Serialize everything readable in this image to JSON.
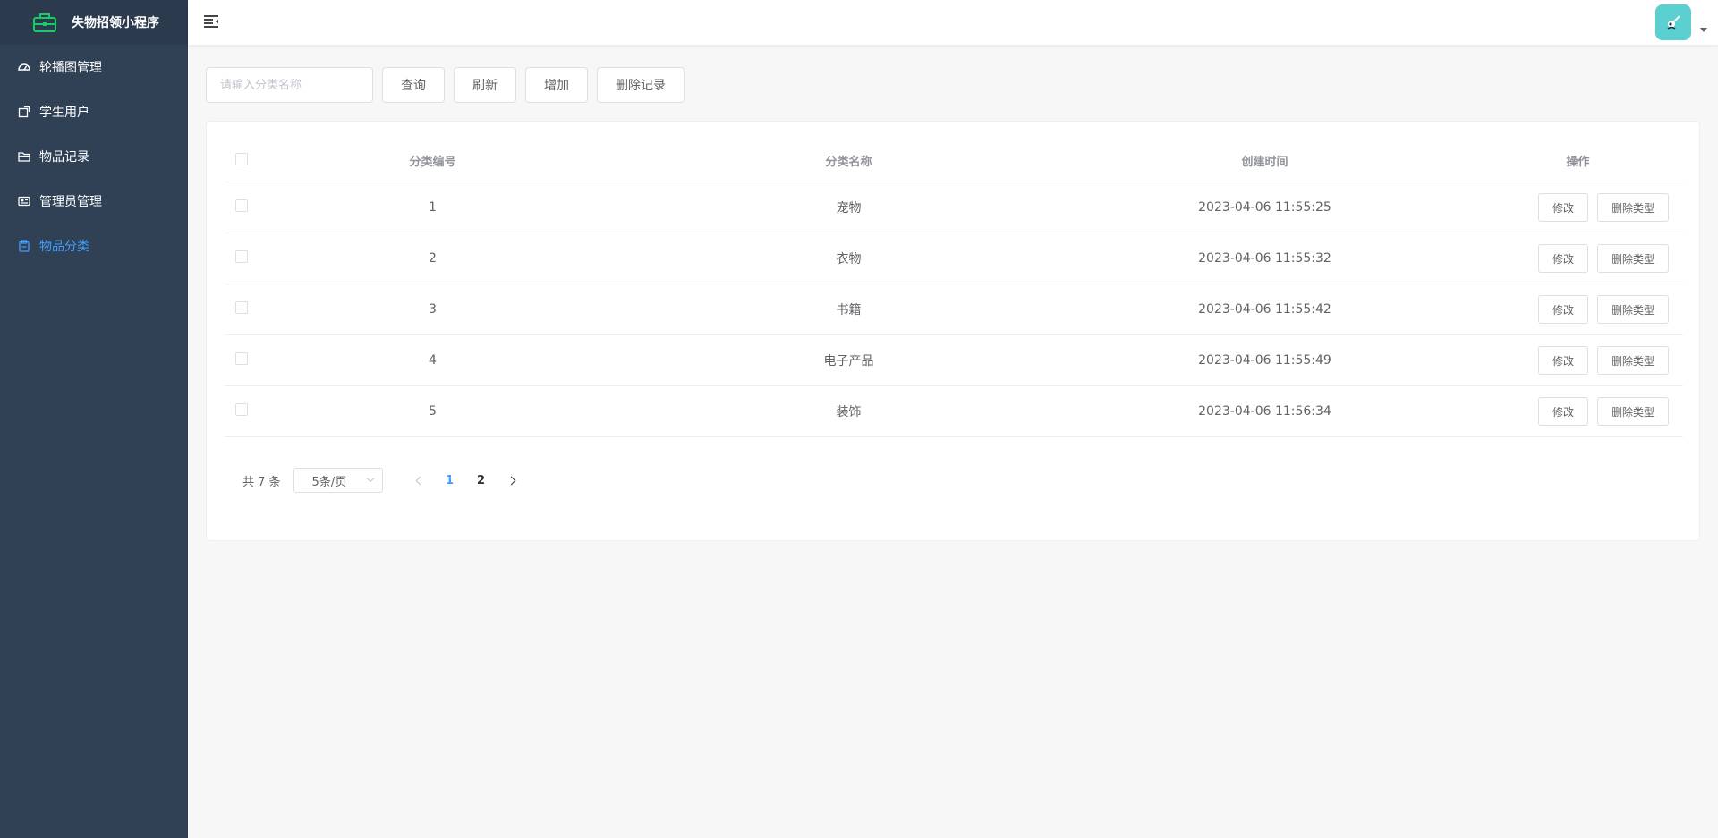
{
  "app": {
    "title": "失物招领小程序"
  },
  "sidebar": {
    "items": [
      {
        "label": "轮播图管理",
        "icon": "dashboard-icon",
        "active": false
      },
      {
        "label": "学生用户",
        "icon": "external-link-icon",
        "active": false
      },
      {
        "label": "物品记录",
        "icon": "folder-icon",
        "active": false
      },
      {
        "label": "管理员管理",
        "icon": "id-card-icon",
        "active": false
      },
      {
        "label": "物品分类",
        "icon": "clipboard-icon",
        "active": true
      }
    ]
  },
  "colors": {
    "sidebar_bg": "#304156",
    "logo_bg": "#2b3a4d",
    "accent": "#409eff",
    "logo_green": "#13ce66",
    "avatar_bg": "#5ccfd0"
  },
  "toolbar": {
    "search_placeholder": "请输入分类名称",
    "query_label": "查询",
    "refresh_label": "刷新",
    "add_label": "增加",
    "delete_records_label": "删除记录"
  },
  "table": {
    "headers": {
      "id": "分类编号",
      "name": "分类名称",
      "created": "创建时间",
      "ops": "操作"
    },
    "rows": [
      {
        "id": "1",
        "name": "宠物",
        "created": "2023-04-06 11:55:25"
      },
      {
        "id": "2",
        "name": "衣物",
        "created": "2023-04-06 11:55:32"
      },
      {
        "id": "3",
        "name": "书籍",
        "created": "2023-04-06 11:55:42"
      },
      {
        "id": "4",
        "name": "电子产品",
        "created": "2023-04-06 11:55:49"
      },
      {
        "id": "5",
        "name": "装饰",
        "created": "2023-04-06 11:56:34"
      }
    ],
    "edit_label": "修改",
    "delete_label": "删除类型"
  },
  "pagination": {
    "total_text": "共 7 条",
    "page_size": "5条/页",
    "pages": [
      "1",
      "2"
    ],
    "current": "1"
  }
}
